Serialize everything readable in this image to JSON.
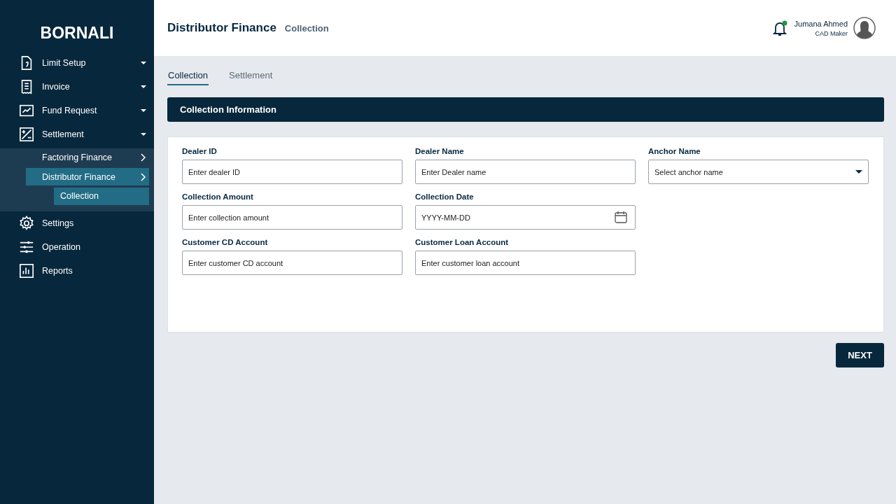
{
  "sidebar": {
    "logo": "BORNALI",
    "items": [
      {
        "label": "Limit Setup",
        "kind": "menu"
      },
      {
        "label": "Invoice",
        "kind": "menu"
      },
      {
        "label": "Fund Request",
        "kind": "menu"
      },
      {
        "label": "Settlement",
        "kind": "menu",
        "children": [
          {
            "label": "Factoring Finance",
            "selected": false
          },
          {
            "label": "Distributor Finance",
            "selected": true,
            "children": [
              {
                "label": "Collection",
                "selected": true
              }
            ]
          }
        ]
      },
      {
        "label": "Settings",
        "kind": "link"
      },
      {
        "label": "Operation",
        "kind": "link"
      },
      {
        "label": "Reports",
        "kind": "link"
      }
    ]
  },
  "header": {
    "title": "Distributor Finance",
    "subtitle": "Collection",
    "notification": {
      "unread": true
    },
    "user": {
      "name": "Jumana Ahmed",
      "role": "CAD Maker"
    }
  },
  "tabs": [
    {
      "label": "Collection",
      "selected": true
    },
    {
      "label": "Settlement",
      "selected": false
    }
  ],
  "section": {
    "title": "Collection Information"
  },
  "form": {
    "rows": [
      [
        {
          "label": "Dealer ID",
          "kind": "text",
          "placeholder": "Enter dealer ID"
        },
        {
          "label": "Dealer Name",
          "kind": "text",
          "placeholder": "Enter Dealer name"
        },
        {
          "label": "Anchor Name",
          "kind": "select",
          "placeholder": "Select anchor name"
        }
      ],
      [
        {
          "label": "Collection Amount",
          "kind": "text",
          "placeholder": "Enter collection amount"
        },
        {
          "label": "Collection Date",
          "kind": "date",
          "placeholder": "YYYY-MM-DD"
        }
      ],
      [
        {
          "label": "Customer CD Account",
          "kind": "text",
          "placeholder": "Enter customer CD account"
        },
        {
          "label": "Customer Loan Account",
          "kind": "text",
          "placeholder": "Enter customer loan account"
        }
      ]
    ]
  },
  "buttons": [
    {
      "label": "NEXT"
    }
  ]
}
